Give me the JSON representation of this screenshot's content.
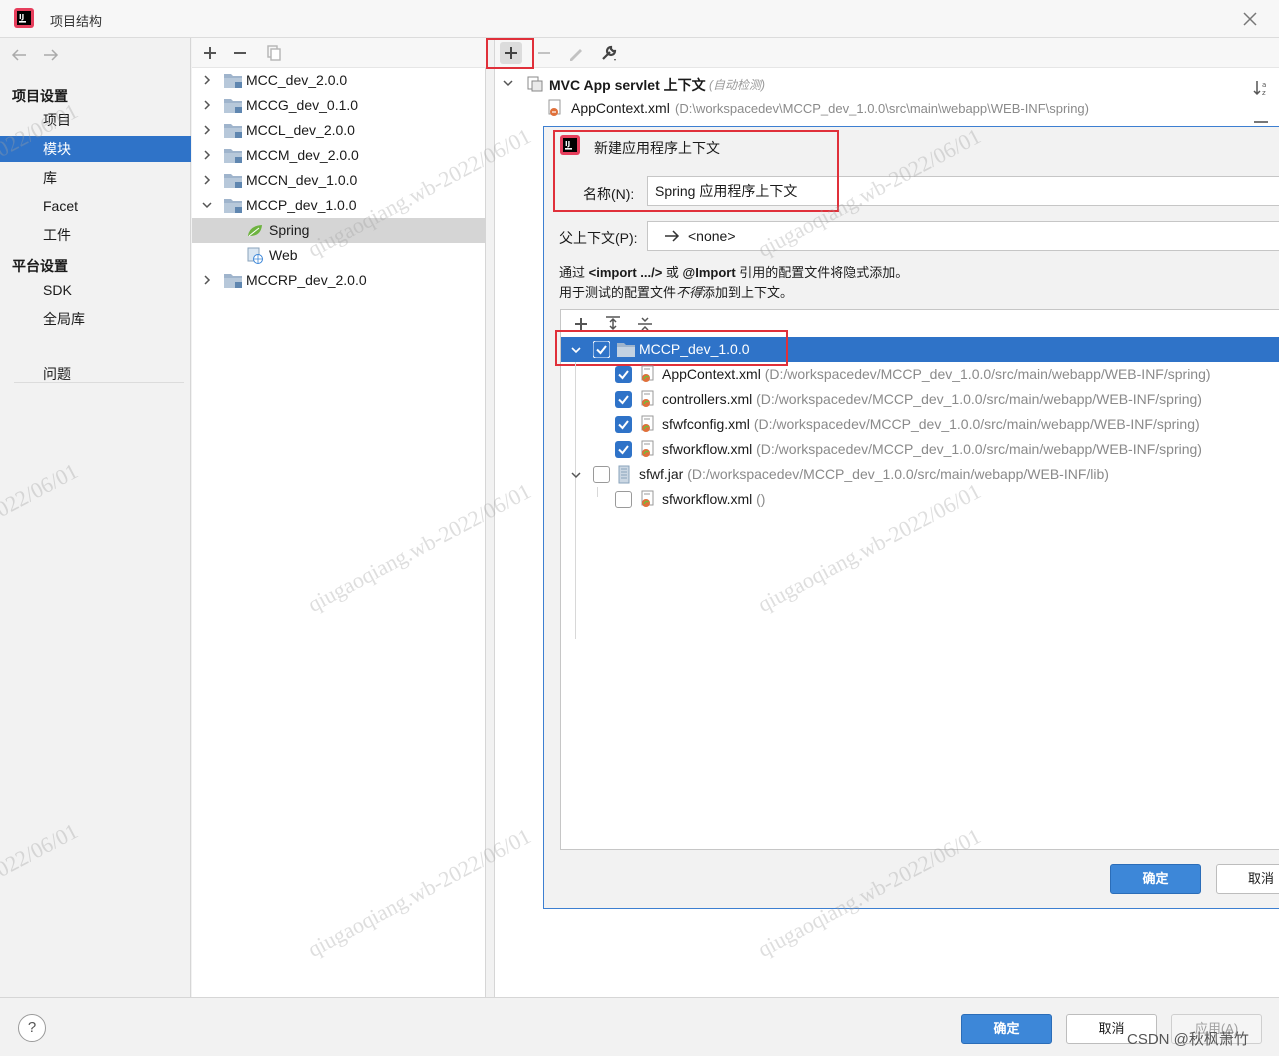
{
  "window": {
    "title": "项目结构"
  },
  "nav": {
    "sections": [
      {
        "label": "项目设置",
        "items": [
          "项目",
          "模块",
          "库",
          "Facet",
          "工件"
        ]
      },
      {
        "label": "平台设置",
        "items": [
          "SDK",
          "全局库"
        ]
      }
    ],
    "problems": "问题",
    "selected": "模块"
  },
  "modules": [
    {
      "name": "MCC_dev_2.0.0",
      "expanded": false
    },
    {
      "name": "MCCG_dev_0.1.0",
      "expanded": false
    },
    {
      "name": "MCCL_dev_2.0.0",
      "expanded": false
    },
    {
      "name": "MCCM_dev_2.0.0",
      "expanded": false
    },
    {
      "name": "MCCN_dev_1.0.0",
      "expanded": false
    },
    {
      "name": "MCCP_dev_1.0.0",
      "expanded": true
    },
    {
      "name": "Spring",
      "child": true,
      "selected": true
    },
    {
      "name": "Web",
      "child": true
    },
    {
      "name": "MCCRP_dev_2.0.0",
      "expanded": false
    }
  ],
  "facet": {
    "context_title": "MVC App servlet 上下文",
    "context_note": "(自动检测)",
    "context_file": "AppContext.xml",
    "context_file_path": "(D:\\workspacedev\\MCCP_dev_1.0.0\\src\\main\\webapp\\WEB-INF\\spring)"
  },
  "dialog": {
    "title": "新建应用程序上下文",
    "name_label": "名称(N):",
    "name_value": "Spring 应用程序上下文",
    "parent_label": "父上下文(P):",
    "parent_value": "<none>",
    "hint_prefix": "通过 ",
    "hint_import": "<import .../>",
    "hint_or": " 或 ",
    "hint_annotation": "@Import",
    "hint_suffix": " 引用的配置文件将隐式添加。",
    "hint2_prefix": "用于测试的配置文件",
    "hint2_em": "不得",
    "hint2_suffix": "添加到上下文。",
    "tree": {
      "root": {
        "name": "MCCP_dev_1.0.0",
        "checked": true
      },
      "files": [
        {
          "name": "AppContext.xml",
          "path": "(D:/workspacedev/MCCP_dev_1.0.0/src/main/webapp/WEB-INF/spring)",
          "checked": true
        },
        {
          "name": "controllers.xml",
          "path": "(D:/workspacedev/MCCP_dev_1.0.0/src/main/webapp/WEB-INF/spring)",
          "checked": true
        },
        {
          "name": "sfwfconfig.xml",
          "path": "(D:/workspacedev/MCCP_dev_1.0.0/src/main/webapp/WEB-INF/spring)",
          "checked": true
        },
        {
          "name": "sfworkflow.xml",
          "path": "(D:/workspacedev/MCCP_dev_1.0.0/src/main/webapp/WEB-INF/spring)",
          "checked": true
        }
      ],
      "jar": {
        "name": "sfwf.jar",
        "path": "(D:/workspacedev/MCCP_dev_1.0.0/src/main/webapp/WEB-INF/lib)",
        "checked": false
      },
      "jar_child": {
        "name": "sfworkflow.xml",
        "path": "()",
        "checked": false
      }
    },
    "ok": "确定",
    "cancel": "取消"
  },
  "footer": {
    "help": "?",
    "ok": "确定",
    "cancel": "取消",
    "apply": "应用(A)",
    "credit": "CSDN @秋枫萧竹"
  },
  "watermark": "qiugaoqiang.wb-2022/06/01",
  "watermark_short": "2022/06/01",
  "colors": {
    "accent": "#2f73c8",
    "highlight_box": "#e0303a",
    "primary_button": "#3d87d8"
  }
}
